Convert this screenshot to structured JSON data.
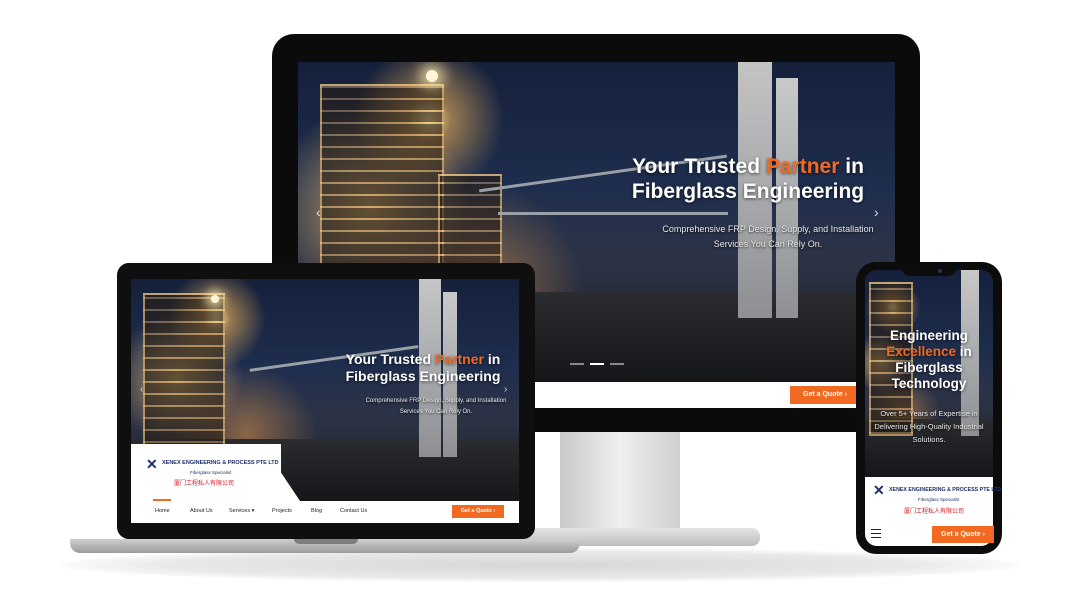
{
  "hero_primary": {
    "title_prefix": "Your Trusted ",
    "title_accent": "Partner",
    "title_suffix": " in",
    "title_line2": "Fiberglass Engineering",
    "subtitle_line1": "Comprehensive FRP Design, Supply, and Installation",
    "subtitle_line2": "Services You Can Rely On."
  },
  "hero_mobile": {
    "title_line1": "Engineering",
    "title_accent": "Excellence",
    "title_suffix": " in",
    "title_line3": "Fiberglass",
    "title_line4": "Technology",
    "subtitle": "Over 5+ Years of Expertise in Delivering High-Quality Industrial Solutions."
  },
  "logo": {
    "name": "XENEX ENGINEERING & PROCESS PTE LTD",
    "tagline": "Fiberglass Specialist",
    "chinese": "厦门工程私人有限公司"
  },
  "nav": {
    "items": [
      "Home",
      "About Us",
      "Services",
      "Projects",
      "Blog",
      "Contact Us"
    ],
    "services_suffix": " ▾"
  },
  "cta": {
    "quote_label": "Get a Quote ›"
  },
  "colors": {
    "accent": "#f26a21",
    "brand_blue": "#1e2f6e",
    "brand_red": "#d0181d"
  }
}
